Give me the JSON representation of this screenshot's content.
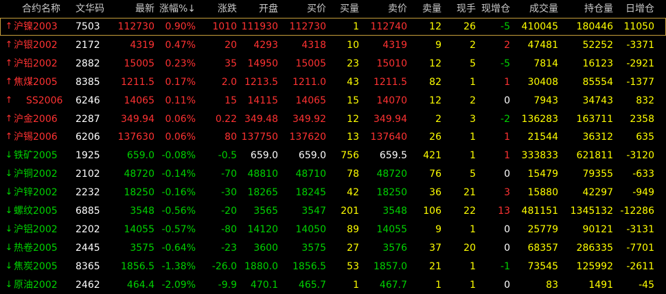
{
  "columns": {
    "name": "合约名称",
    "code": "文华码",
    "last": "最新",
    "change_pct": "涨幅%↓",
    "change": "涨跌",
    "open": "开盘",
    "bid": "买价",
    "bid_vol": "买量",
    "ask": "卖价",
    "ask_vol": "卖量",
    "current_hand": "现手",
    "oi_change_now": "现增仓",
    "volume": "成交量",
    "open_interest": "持仓量",
    "oi_change_day": "日增仓"
  },
  "colors": {
    "up": "#ff3232",
    "down": "#00d200",
    "flat": "#ffffff",
    "neutral": "#ffff00",
    "header": "#c9c9c9",
    "selected_border": "#c8a03c"
  },
  "icons": {
    "up": "up-arrow-icon",
    "down": "down-arrow-icon"
  },
  "rows": [
    {
      "dir": "up",
      "name": "沪镍2003",
      "code": "7503",
      "last": "112730",
      "change_pct": "0.90%",
      "change": "1010",
      "open": "111930",
      "bid": "112730",
      "bid_vol": "1",
      "ask": "112740",
      "ask_vol": "12",
      "current_hand": "26",
      "oi_change_now": "-5",
      "volume": "410045",
      "open_interest": "180446",
      "oi_change_day": "11050"
    },
    {
      "dir": "up",
      "name": "沪银2002",
      "code": "2172",
      "last": "4319",
      "change_pct": "0.47%",
      "change": "20",
      "open": "4293",
      "bid": "4318",
      "bid_vol": "10",
      "ask": "4319",
      "ask_vol": "9",
      "current_hand": "2",
      "oi_change_now": "2",
      "volume": "47481",
      "open_interest": "52252",
      "oi_change_day": "-3371"
    },
    {
      "dir": "up",
      "name": "沪铅2002",
      "code": "2882",
      "last": "15005",
      "change_pct": "0.23%",
      "change": "35",
      "open": "14950",
      "bid": "15005",
      "bid_vol": "23",
      "ask": "15010",
      "ask_vol": "12",
      "current_hand": "5",
      "oi_change_now": "-5",
      "volume": "7814",
      "open_interest": "16123",
      "oi_change_day": "-2921"
    },
    {
      "dir": "up",
      "name": "焦煤2005",
      "code": "8385",
      "last": "1211.5",
      "change_pct": "0.17%",
      "change": "2.0",
      "open": "1213.5",
      "bid": "1211.0",
      "bid_vol": "43",
      "ask": "1211.5",
      "ask_vol": "82",
      "current_hand": "1",
      "oi_change_now": "1",
      "volume": "30408",
      "open_interest": "85554",
      "oi_change_day": "-1377"
    },
    {
      "dir": "up",
      "name": "SS2006",
      "code": "6246",
      "last": "14065",
      "change_pct": "0.11%",
      "change": "15",
      "open": "14115",
      "bid": "14065",
      "bid_vol": "15",
      "ask": "14070",
      "ask_vol": "12",
      "current_hand": "2",
      "oi_change_now": "0",
      "volume": "7943",
      "open_interest": "34743",
      "oi_change_day": "832"
    },
    {
      "dir": "up",
      "name": "沪金2006",
      "code": "2287",
      "last": "349.94",
      "change_pct": "0.06%",
      "change": "0.22",
      "open": "349.48",
      "bid": "349.92",
      "bid_vol": "12",
      "ask": "349.94",
      "ask_vol": "2",
      "current_hand": "3",
      "oi_change_now": "-2",
      "volume": "136283",
      "open_interest": "163711",
      "oi_change_day": "2358"
    },
    {
      "dir": "up",
      "name": "沪锡2006",
      "code": "6206",
      "last": "137630",
      "change_pct": "0.06%",
      "change": "80",
      "open": "137750",
      "bid": "137620",
      "bid_vol": "13",
      "ask": "137640",
      "ask_vol": "26",
      "current_hand": "1",
      "oi_change_now": "1",
      "volume": "21544",
      "open_interest": "36312",
      "oi_change_day": "635"
    },
    {
      "dir": "down",
      "name": "铁矿2005",
      "code": "1925",
      "last": "659.0",
      "change_pct": "-0.08%",
      "change": "-0.5",
      "open": "659.0",
      "bid": "659.0",
      "bid_vol": "756",
      "ask": "659.5",
      "ask_vol": "421",
      "current_hand": "1",
      "oi_change_now": "1",
      "volume": "333833",
      "open_interest": "621811",
      "oi_change_day": "-3120"
    },
    {
      "dir": "down",
      "name": "沪铜2002",
      "code": "2102",
      "last": "48720",
      "change_pct": "-0.14%",
      "change": "-70",
      "open": "48810",
      "bid": "48710",
      "bid_vol": "78",
      "ask": "48720",
      "ask_vol": "76",
      "current_hand": "5",
      "oi_change_now": "0",
      "volume": "15479",
      "open_interest": "79355",
      "oi_change_day": "-633"
    },
    {
      "dir": "down",
      "name": "沪锌2002",
      "code": "2232",
      "last": "18250",
      "change_pct": "-0.16%",
      "change": "-30",
      "open": "18265",
      "bid": "18245",
      "bid_vol": "42",
      "ask": "18250",
      "ask_vol": "36",
      "current_hand": "21",
      "oi_change_now": "3",
      "volume": "15880",
      "open_interest": "42297",
      "oi_change_day": "-949"
    },
    {
      "dir": "down",
      "name": "螺纹2005",
      "code": "6885",
      "last": "3548",
      "change_pct": "-0.56%",
      "change": "-20",
      "open": "3565",
      "bid": "3547",
      "bid_vol": "201",
      "ask": "3548",
      "ask_vol": "106",
      "current_hand": "22",
      "oi_change_now": "13",
      "volume": "481151",
      "open_interest": "1345132",
      "oi_change_day": "-12286"
    },
    {
      "dir": "down",
      "name": "沪铝2002",
      "code": "2202",
      "last": "14055",
      "change_pct": "-0.57%",
      "change": "-80",
      "open": "14120",
      "bid": "14050",
      "bid_vol": "89",
      "ask": "14055",
      "ask_vol": "9",
      "current_hand": "1",
      "oi_change_now": "0",
      "volume": "25779",
      "open_interest": "90121",
      "oi_change_day": "-3131"
    },
    {
      "dir": "down",
      "name": "热卷2005",
      "code": "2445",
      "last": "3575",
      "change_pct": "-0.64%",
      "change": "-23",
      "open": "3600",
      "bid": "3575",
      "bid_vol": "27",
      "ask": "3576",
      "ask_vol": "37",
      "current_hand": "20",
      "oi_change_now": "0",
      "volume": "68357",
      "open_interest": "286335",
      "oi_change_day": "-7701"
    },
    {
      "dir": "down",
      "name": "焦炭2005",
      "code": "8365",
      "last": "1856.5",
      "change_pct": "-1.38%",
      "change": "-26.0",
      "open": "1880.0",
      "bid": "1856.5",
      "bid_vol": "53",
      "ask": "1857.0",
      "ask_vol": "21",
      "current_hand": "1",
      "oi_change_now": "-1",
      "volume": "73545",
      "open_interest": "125992",
      "oi_change_day": "-2611"
    },
    {
      "dir": "down",
      "name": "原油2002",
      "code": "2462",
      "last": "464.4",
      "change_pct": "-2.09%",
      "change": "-9.9",
      "open": "470.1",
      "bid": "465.7",
      "bid_vol": "1",
      "ask": "467.7",
      "ask_vol": "1",
      "current_hand": "1",
      "oi_change_now": "0",
      "volume": "83",
      "open_interest": "1491",
      "oi_change_day": "-45"
    }
  ]
}
